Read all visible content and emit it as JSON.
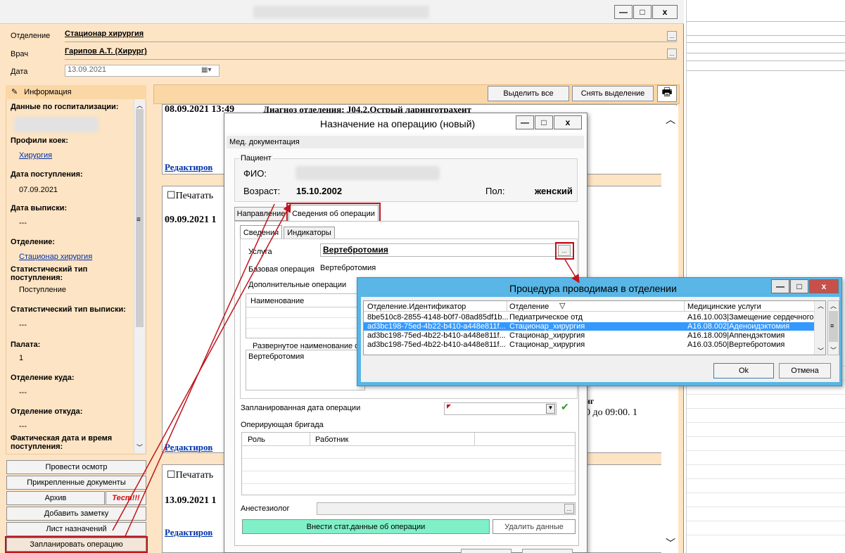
{
  "main_window": {
    "minimize": "—",
    "maximize": "□",
    "close": "x",
    "labels": {
      "department": "Отделение",
      "doctor": "Врач",
      "date": "Дата"
    },
    "department_value": "Стационар хирургия",
    "doctor_value": "Гарипов А.Т. (Хирург)",
    "date_value": "13.09.2021",
    "ellipsis": "..."
  },
  "sidebar": {
    "info_tab": "Информация",
    "fields": [
      {
        "label": "Данные по госпитализации:",
        "value": ""
      },
      {
        "label": "Профили коек:",
        "value": "Хирургия"
      },
      {
        "label": "Дата поступления:",
        "value": "07.09.2021"
      },
      {
        "label": "Дата выписки:",
        "value": "---"
      },
      {
        "label": "Отделение:",
        "value": "Стационар хирургия"
      },
      {
        "label": "Статистический тип поступления:",
        "value": "Поступление"
      },
      {
        "label": "Статистический тип выписки:",
        "value": "---"
      },
      {
        "label": "Палата:",
        "value": "1"
      },
      {
        "label": "Отделение куда:",
        "value": "---"
      },
      {
        "label": "Отделение откуда:",
        "value": "---"
      },
      {
        "label": "Фактическая дата и время поступления:",
        "value": ""
      }
    ],
    "buttons": {
      "exam": "Провести осмотр",
      "docs": "Прикрепленные документы",
      "archive": "Архив",
      "test": "Тест!!!",
      "add_note": "Добавить заметку",
      "prescriptions": "Лист назначений",
      "plan_operation": "Запланировать операцию"
    }
  },
  "content": {
    "select_all": "Выделить все",
    "deselect": "Снять выделение",
    "record1_date": "08.09.2021 13:49",
    "record1_diag": "Диагноз отделения: J04.2.Острый ларинготрахеит",
    "edit_link": "Редактиров",
    "print_label": "Печатать",
    "record2_date": "09.09.2021 1",
    "record2_tail": "иг",
    "record2_tail2": "0 до 09:00. 1",
    "record3_date": "13.09.2021 1"
  },
  "op_dialog": {
    "title": "Назначение на операцию (новый)",
    "section": "Мед. документация",
    "patient_group": "Пациент",
    "fio_label": "ФИО:",
    "age_label": "Возраст:",
    "age_value": "15.10.2002",
    "sex_label": "Пол:",
    "sex_value": "женский",
    "tabs": [
      "Направление",
      "Сведения об операции"
    ],
    "subtabs": [
      "Сведения",
      "Индикаторы"
    ],
    "service_label": "Услуга",
    "service_value": "Вертебротомия",
    "base_op_label": "Базовая операция",
    "base_op_value": "Вертебротомия",
    "extra_ops_label": "Дополнительные операции",
    "name_col": "Наименование",
    "expanded_label": "Развернутое наименование о",
    "expanded_value": "Вертебротомия",
    "planned_date_label": "Запланированная дата операции",
    "team_label": "Оперирующая бригада",
    "team_cols": [
      "Роль",
      "Работник"
    ],
    "anesth_label": "Анестезиолог",
    "stat_btn": "Внести стат.данные об операции",
    "delete_btn": "Удалить данные"
  },
  "proc_dialog": {
    "title": "Процедура проводимая в отделении",
    "columns": [
      "Отделение.Идентификатор",
      "Отделение",
      "Медицинские услуги"
    ],
    "rows": [
      {
        "id": "8be510c8-2855-4148-b0f7-08ad85df1b...",
        "dept": "Педиатрическое отд",
        "service": "A16.10.003|Замещение сердечного"
      },
      {
        "id": "ad3bc198-75ed-4b22-b410-a448e811f...",
        "dept": "Стационар_хирургия",
        "service": "A16.08.002|Аденоидэктомия"
      },
      {
        "id": "ad3bc198-75ed-4b22-b410-a448e811f...",
        "dept": "Стационар_хирургия",
        "service": "A16.18.009|Аппендэктомия"
      },
      {
        "id": "ad3bc198-75ed-4b22-b410-a448e811f...",
        "dept": "Стационар_хирургия",
        "service": "A16.03.050|Вертебротомия"
      }
    ],
    "ok": "Ok",
    "cancel": "Отмена"
  },
  "colors": {
    "peach": "#fde4c4",
    "peach_header": "#fbd7a6",
    "selection": "#3399ff",
    "dialog_frame": "#59b6e6",
    "stat_btn": "#80f0c8",
    "annotation": "#c0141c"
  }
}
